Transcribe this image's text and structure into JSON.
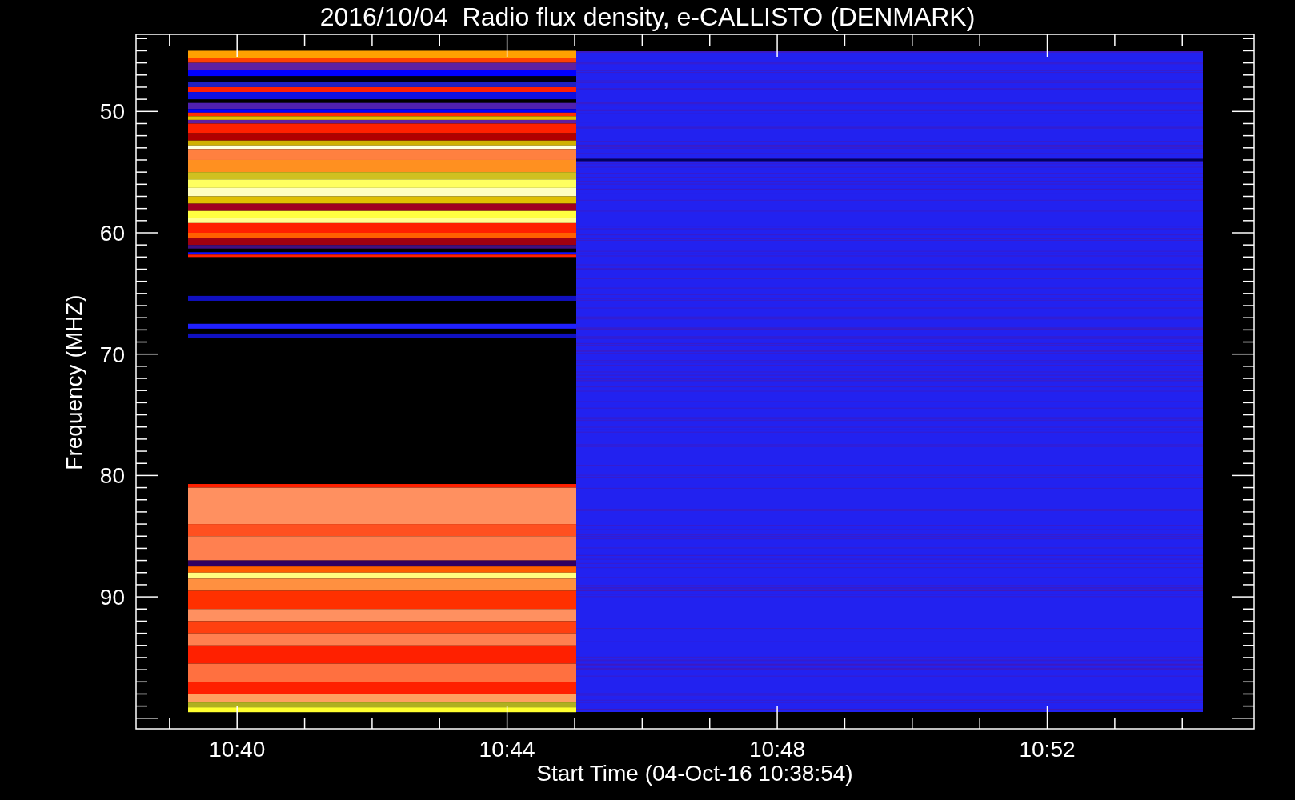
{
  "plot": {
    "title": "2016/10/04  Radio flux density, e-CALLISTO (DENMARK)",
    "y_axis_label": "Frequency (MHZ)",
    "y_tick_labels": [
      "50",
      "60",
      "70",
      "80",
      "90"
    ],
    "x_tick_labels": [
      "10:40",
      "10:44",
      "10:48",
      "10:52"
    ],
    "x_axis_label": "Start Time (04-Oct-16 10:38:54)"
  }
}
